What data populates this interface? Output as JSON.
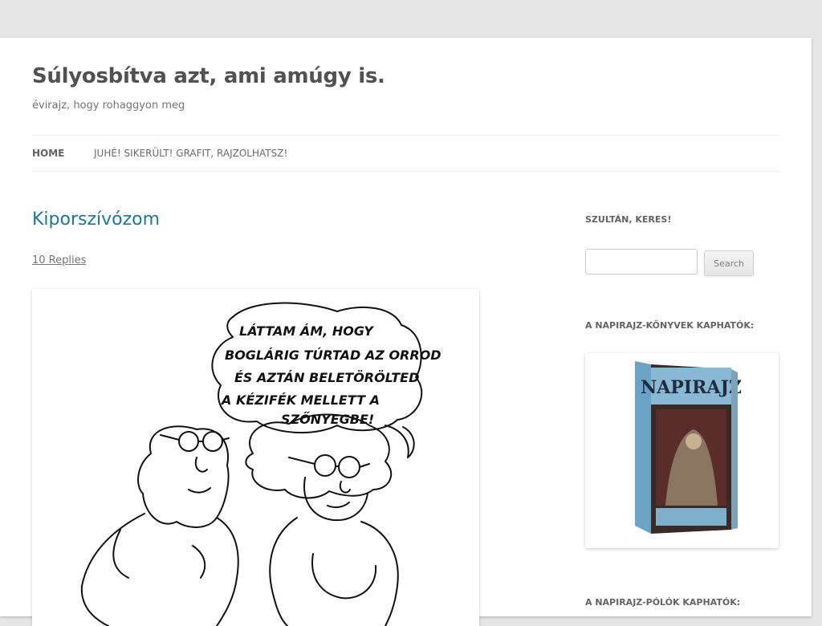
{
  "site": {
    "title": "Súlyosbítva azt, ami amúgy is.",
    "description": "évirajz, hogy rohaggyon meg"
  },
  "nav": {
    "items": [
      {
        "label": "Home"
      },
      {
        "label": "Juhé! Sikerült! Grafit, rajzolhatsz!"
      }
    ]
  },
  "post": {
    "title": "Kiporszívózom",
    "replies": "10 Replies",
    "speech_bubble": [
      "LÁTTAM ÁM, HOGY",
      "BOGLÁRIG TÚRTAD AZ ORROD",
      "ÉS AZTÁN BELETÖRÖLTED",
      "A KÉZIFÉK MELLETT A",
      "SZŐNYEGBE!"
    ]
  },
  "sidebar": {
    "search_widget_title": "Szultán, keres!",
    "search_placeholder": "",
    "search_button": "Search",
    "books_widget_title": "A napirajz-könyvek kaphatók:",
    "book_cover_title": "NAPIRAJZ",
    "shirts_widget_title": "A napirajz-pólók kaphatók:"
  },
  "colors": {
    "link": "#21759b",
    "background": "#e6e6e6"
  }
}
